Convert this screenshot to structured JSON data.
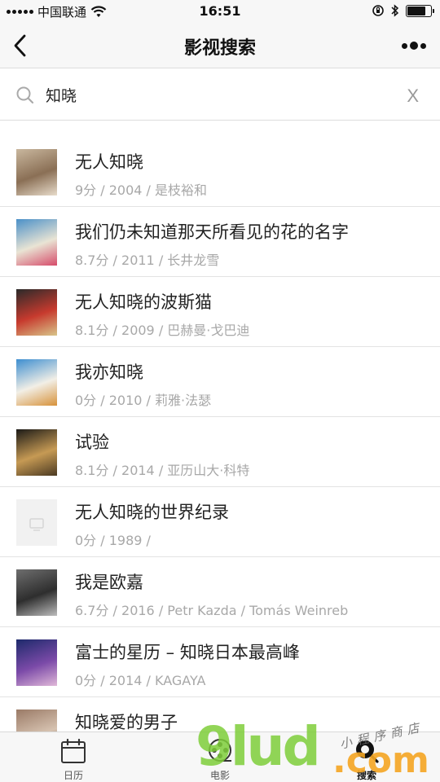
{
  "status_bar": {
    "carrier": "中国联通",
    "time": "16:51",
    "battery_level": 0.8
  },
  "nav": {
    "title": "影视搜索",
    "back_icon": "chevron-left-icon",
    "more_icon": "more-dots-icon"
  },
  "search": {
    "query": "知晓",
    "clear_label": "X",
    "icon": "search-icon"
  },
  "results": [
    {
      "title": "无人知晓",
      "meta": "9分 / 2004 / 是枝裕和",
      "poster_colors": [
        "#c9b79e",
        "#8a6f55",
        "#e8dccb"
      ],
      "placeholder": false
    },
    {
      "title": "我们仍未知道那天所看见的花的名字",
      "meta": "8.7分 / 2011 / 长井龙雪",
      "poster_colors": [
        "#4a90c8",
        "#e9e4d4",
        "#d64b6a"
      ],
      "placeholder": false
    },
    {
      "title": "无人知晓的波斯猫",
      "meta": "8.1分 / 2009 / 巴赫曼·戈巴迪",
      "poster_colors": [
        "#2a2a2a",
        "#c73a2e",
        "#d8c58a"
      ],
      "placeholder": false
    },
    {
      "title": "我亦知晓",
      "meta": "0分 / 2010 / 莉雅·法瑟",
      "poster_colors": [
        "#3d8ed0",
        "#f2efe6",
        "#d7923a"
      ],
      "placeholder": false
    },
    {
      "title": "试验",
      "meta": "8.1分 / 2014 / 亚历山大·科特",
      "poster_colors": [
        "#1b1a17",
        "#c69a54",
        "#4b3a22"
      ],
      "placeholder": false
    },
    {
      "title": "无人知晓的世界纪录",
      "meta": "0分 / 1989 /",
      "poster_colors": [
        "#f1f1f1",
        "#f1f1f1",
        "#f1f1f1"
      ],
      "placeholder": true
    },
    {
      "title": "我是欧嘉",
      "meta": "6.7分 / 2016 / Petr Kazda / Tomás Weinreb",
      "poster_colors": [
        "#6e6e6e",
        "#2e2e2e",
        "#bcbcbc"
      ],
      "placeholder": false
    },
    {
      "title": "富士的星历 – 知晓日本最高峰",
      "meta": "0分 / 2014 / KAGAYA",
      "poster_colors": [
        "#1d2a6b",
        "#7b4aa8",
        "#e0b8d8"
      ],
      "placeholder": false
    },
    {
      "title": "知晓爱的男子",
      "meta": "",
      "poster_colors": [
        "#9a7a66",
        "#d6c2b0",
        "#5a4638"
      ],
      "placeholder": false
    }
  ],
  "tabs": [
    {
      "label": "日历",
      "icon": "calendar-icon",
      "active": false
    },
    {
      "label": "电影",
      "icon": "film-reel-icon",
      "active": false
    },
    {
      "label": "搜索",
      "icon": "search-tab-icon",
      "active": true
    }
  ],
  "watermark": {
    "main": "9lud",
    "tld": ".com",
    "sub": "小程序商店"
  }
}
